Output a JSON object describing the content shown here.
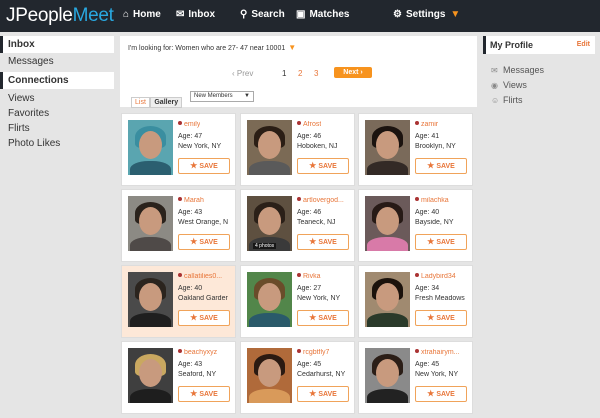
{
  "brand": {
    "j": "J",
    "people": "People",
    "meet": "Meet"
  },
  "nav": {
    "home": "Home",
    "inbox": "Inbox",
    "search": "Search",
    "matches": "Matches",
    "settings": "Settings"
  },
  "left_nav": [
    "Inbox",
    "Messages",
    "Connections",
    "Views",
    "Favorites",
    "Flirts",
    "Photo Likes"
  ],
  "search": {
    "looking_for": "I'm looking for: Women who are 27- 47 near 10001",
    "prev": "Prev",
    "pages": [
      "1",
      "2",
      "3"
    ],
    "next": "Next",
    "view_list": "List",
    "view_gallery": "Gallery",
    "sort_selected": "New Members"
  },
  "right_panel": {
    "title": "My Profile",
    "edit": "Edit",
    "links": [
      "Messages",
      "Views",
      "Flirts"
    ]
  },
  "save_label": "SAVE",
  "cards": [
    {
      "name": "emily",
      "age": "Age: 47",
      "loc": "New York, NY",
      "photo_bg": "#5aa5b0",
      "hair": "#3a8ea0",
      "body": "#2b5f70"
    },
    {
      "name": "Afrost",
      "age": "Age: 46",
      "loc": "Hoboken, NJ",
      "photo_bg": "#7b6a55",
      "hair": "#2b1e15",
      "body": "#5a5a5a"
    },
    {
      "name": "zamir",
      "age": "Age: 41",
      "loc": "Brooklyn, NY",
      "photo_bg": "#7a6a5a",
      "hair": "#1b130f",
      "body": "#332a26"
    },
    {
      "name": "Marah",
      "age": "Age: 43",
      "loc": "West Orange, N",
      "photo_bg": "#8c8a84",
      "hair": "#2a221c",
      "body": "#4f4a48"
    },
    {
      "name": "artlovergod...",
      "age": "Age: 46",
      "loc": "Teaneck, NJ",
      "photo_bg": "#5e5040",
      "hair": "#2b2018",
      "body": "#3a3a3a",
      "badge": "4 photos"
    },
    {
      "name": "milachka",
      "age": "Age: 40",
      "loc": "Bayside, NY",
      "photo_bg": "#6b5a5a",
      "hair": "#271a16",
      "body": "#d87aa8"
    },
    {
      "name": "callatilies0...",
      "age": "Age: 40",
      "loc": "Oakland Garder",
      "photo_bg": "#4a4a4a",
      "hair": "#2b241e",
      "body": "#1f1f1f",
      "hl": true
    },
    {
      "name": "Rivka",
      "age": "Age: 27",
      "loc": "New York, NY",
      "photo_bg": "#52864a",
      "hair": "#6a4c2a",
      "body": "#2a5a6a"
    },
    {
      "name": "Ladybird34",
      "age": "Age: 34",
      "loc": "Fresh Meadows",
      "photo_bg": "#a08a70",
      "hair": "#1b120c",
      "body": "#2a3a2a"
    },
    {
      "name": "beachyxyz",
      "age": "Age: 43",
      "loc": "Seaford, NY",
      "photo_bg": "#3f3f3f",
      "hair": "#c9a860",
      "body": "#1e1e1e"
    },
    {
      "name": "rcgbtfly7",
      "age": "Age: 45",
      "loc": "Cedarhurst, NY",
      "photo_bg": "#b06a3a",
      "hair": "#2a1a12",
      "body": "#d99a5a"
    },
    {
      "name": "xtrahairym...",
      "age": "Age: 45",
      "loc": "New York, NY",
      "photo_bg": "#8a8a8a",
      "hair": "#2b1e17",
      "body": "#222222"
    }
  ]
}
